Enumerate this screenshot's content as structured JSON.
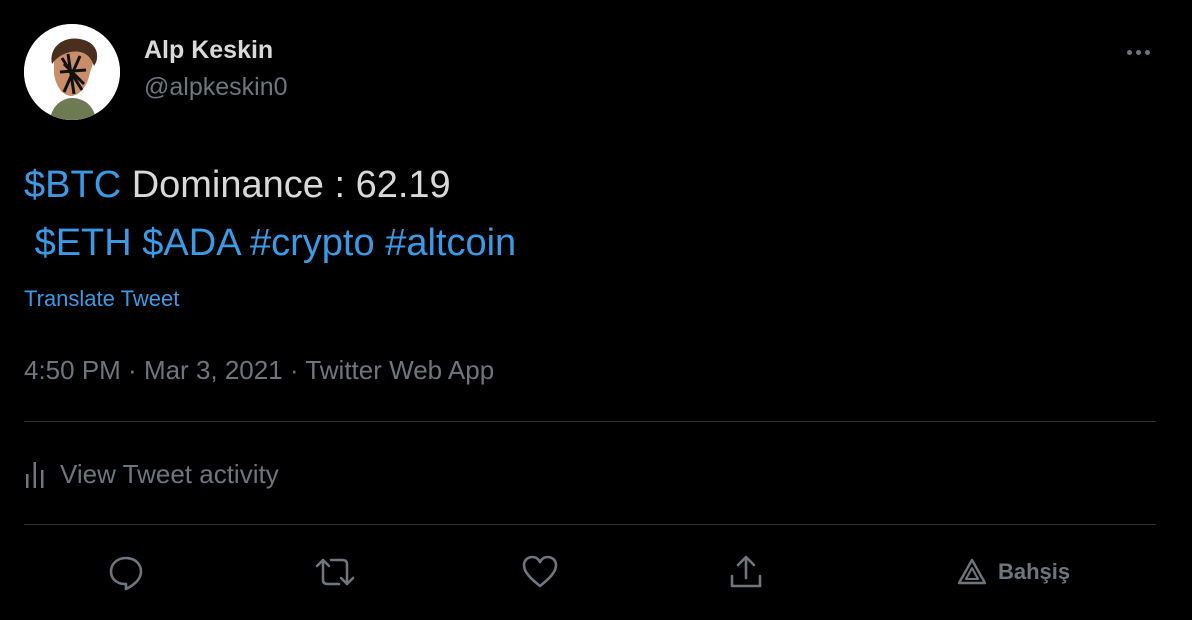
{
  "author": {
    "display_name": "Alp Keskin",
    "handle": "@alpkeskin0"
  },
  "tweet": {
    "line1": {
      "cashtag": "$BTC",
      "text": " Dominance : 62.19"
    },
    "line2": {
      "prefix": " ",
      "tags": [
        "$ETH",
        "$ADA",
        "#crypto",
        "#altcoin"
      ]
    },
    "translate_label": "Translate Tweet",
    "meta": {
      "time": "4:50 PM",
      "date": "Mar 3, 2021",
      "source": "Twitter Web App",
      "separator": " · "
    }
  },
  "activity": {
    "label": "View Tweet activity",
    "icon": "analytics-bars-icon"
  },
  "actions": {
    "reply_icon": "reply-icon",
    "retweet_icon": "retweet-icon",
    "like_icon": "heart-icon",
    "share_icon": "share-icon",
    "tip_icon": "tip-icon",
    "tip_label": "Bahşiş"
  },
  "colors": {
    "background": "#000000",
    "text": "#d9d9d9",
    "muted": "#6e767d",
    "link": "#3a9ae6",
    "divider": "#2f3336"
  }
}
